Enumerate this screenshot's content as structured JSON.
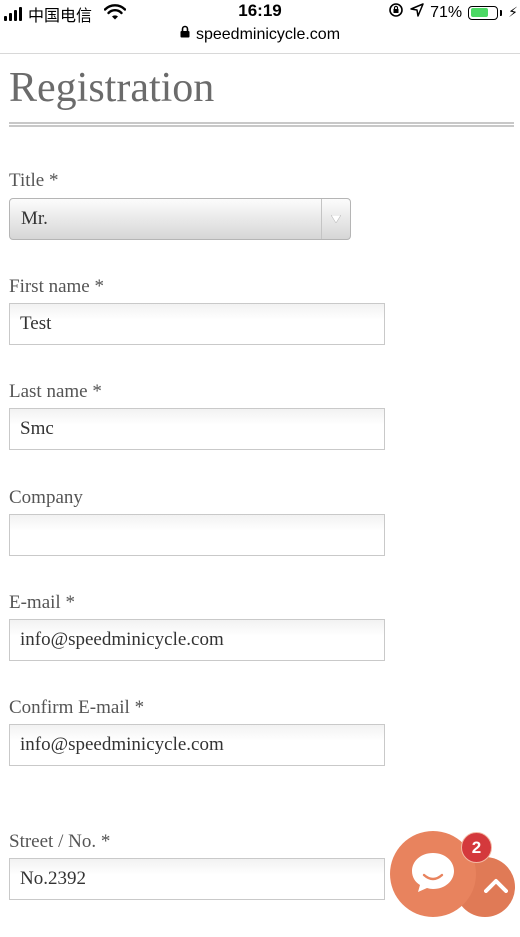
{
  "status_bar": {
    "carrier": "中国电信",
    "time": "16:19",
    "battery_percent": "71%",
    "battery_level": 0.71
  },
  "browser": {
    "domain": "speedminicycle.com"
  },
  "page": {
    "title": "Registration"
  },
  "form": {
    "title_label": "Title *",
    "title_value": "Mr.",
    "first_name_label": "First name *",
    "first_name_value": "Test",
    "last_name_label": "Last name *",
    "last_name_value": "Smc",
    "company_label": "Company",
    "company_value": "",
    "email_label": "E-mail *",
    "email_value": "info@speedminicycle.com",
    "confirm_email_label": "Confirm E-mail *",
    "confirm_email_value": "info@speedminicycle.com",
    "street_label": "Street / No. *",
    "street_value": "No.2392"
  },
  "chat": {
    "badge_count": "2",
    "accent_color": "#e8835e",
    "badge_color": "#d4393c"
  }
}
